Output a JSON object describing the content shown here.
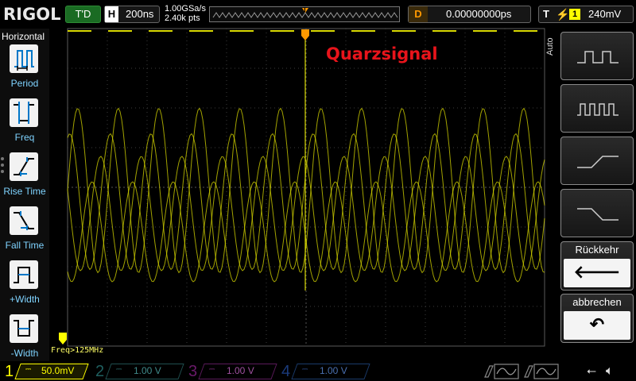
{
  "brand": "RIGOL",
  "status": "T'D",
  "timebase": {
    "key": "H",
    "value": "200ns"
  },
  "acquisition": {
    "sample_rate": "1.00GSa/s",
    "memory_depth": "2.40k pts"
  },
  "memory_marker": "T",
  "delay": {
    "key": "D",
    "value": "0.00000000ps"
  },
  "trigger": {
    "key": "T",
    "edge": "rising",
    "channel": "1",
    "level": "240mV"
  },
  "left_menu": {
    "title": "Horizontal",
    "items": [
      {
        "label": "Period",
        "icon": "period-icon"
      },
      {
        "label": "Freq",
        "icon": "frequency-icon"
      },
      {
        "label": "Rise Time",
        "icon": "rise-time-icon"
      },
      {
        "label": "Fall Time",
        "icon": "fall-time-icon"
      },
      {
        "label": "+Width",
        "icon": "positive-width-icon"
      },
      {
        "label": "-Width",
        "icon": "negative-width-icon"
      }
    ]
  },
  "annotation": "Quarzsignal",
  "measurement": "Freq>125MHz",
  "right_menu": {
    "mode": "Auto",
    "buttons": [
      {
        "icon": "single-pulse-icon"
      },
      {
        "icon": "pulse-train-icon"
      },
      {
        "icon": "rising-edge-icon"
      },
      {
        "icon": "falling-edge-icon"
      }
    ],
    "back": {
      "label": "Rückkehr",
      "glyph": "🡐"
    },
    "cancel": {
      "label": "abbrechen",
      "glyph": "↶"
    }
  },
  "channels": [
    {
      "num": "1",
      "scale": "50.0mV",
      "color": "#ffff00",
      "active": true
    },
    {
      "num": "2",
      "scale": "1.00 V",
      "color": "#00c0c0",
      "active": false
    },
    {
      "num": "3",
      "scale": "1.00 V",
      "color": "#ff00ff",
      "active": false
    },
    {
      "num": "4",
      "scale": "1.00 V",
      "color": "#1e90ff",
      "active": false
    }
  ],
  "colors": {
    "trace": "#d8d800",
    "accent": "#ff9900",
    "annotation": "#e8141b"
  }
}
